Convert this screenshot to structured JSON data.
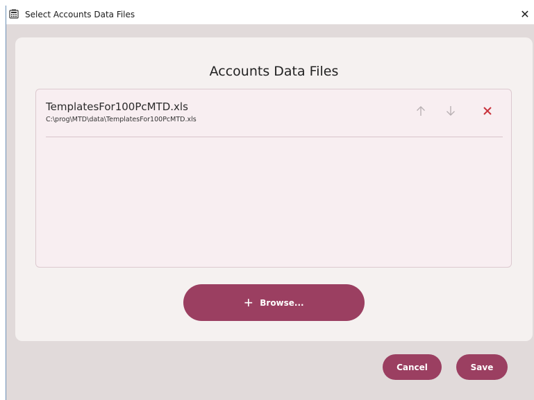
{
  "window": {
    "title": "Select Accounts Data Files",
    "close_glyph": "✕",
    "icon": "calculator-icon"
  },
  "dialog": {
    "heading": "Accounts Data Files",
    "files": [
      {
        "name": "TemplatesFor100PcMTD.xls",
        "path": "C:\\prog\\MTD\\data\\TemplatesFor100PcMTD.xls"
      }
    ],
    "browse_label": "Browse...",
    "browse_icon": "plus-icon"
  },
  "footer": {
    "cancel_label": "Cancel",
    "save_label": "Save"
  },
  "colors": {
    "accent": "#9b3f61",
    "remove": "#c8323c",
    "arrow_disabled": "#b8b0b3",
    "list_background": "#f8eef1",
    "card_background": "#f5f1f0",
    "window_background": "#e1dada"
  }
}
